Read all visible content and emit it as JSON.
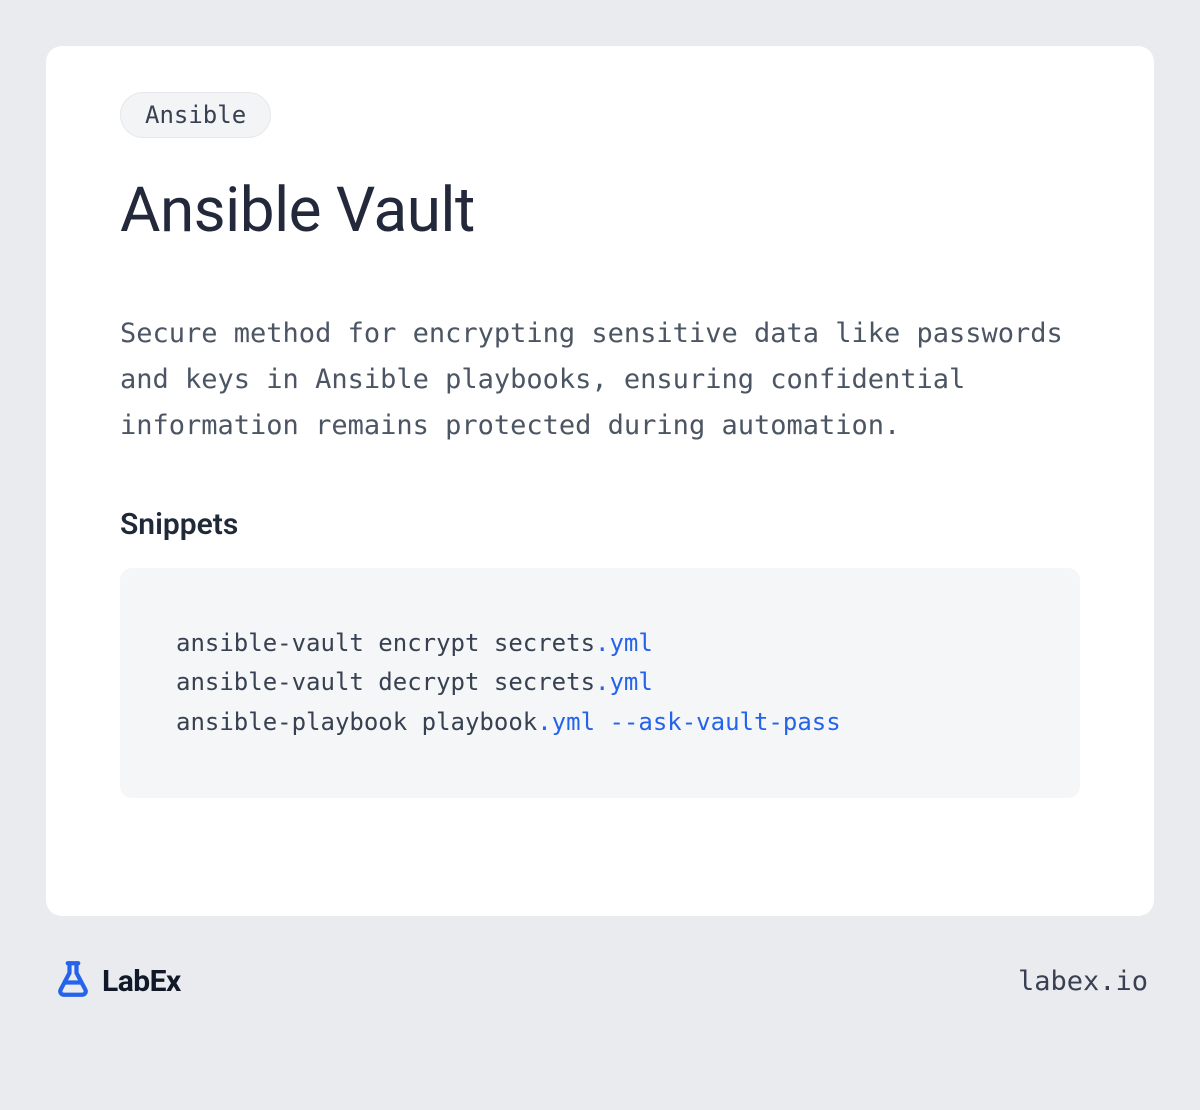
{
  "card": {
    "tag": "Ansible",
    "title": "Ansible Vault",
    "description": "Secure method for encrypting sensitive data like passwords and keys in Ansible playbooks, ensuring confidential information remains protected during automation.",
    "snippets_heading": "Snippets",
    "snippet": {
      "lines": [
        {
          "tokens": [
            {
              "t": "ansible-vault encrypt secrets",
              "c": "plain"
            },
            {
              "t": ".yml",
              "c": "blue"
            }
          ]
        },
        {
          "tokens": [
            {
              "t": "ansible-vault decrypt secrets",
              "c": "plain"
            },
            {
              "t": ".yml",
              "c": "blue"
            }
          ]
        },
        {
          "tokens": [
            {
              "t": "ansible-playbook playbook",
              "c": "plain"
            },
            {
              "t": ".yml --ask-vault-pass",
              "c": "blue"
            }
          ]
        }
      ]
    }
  },
  "footer": {
    "logo_text": "LabEx",
    "site": "labex.io"
  },
  "colors": {
    "accent": "#2563eb",
    "page_bg": "#e9ebee",
    "card_bg": "#ffffff",
    "snippet_bg": "#f5f6f8"
  }
}
